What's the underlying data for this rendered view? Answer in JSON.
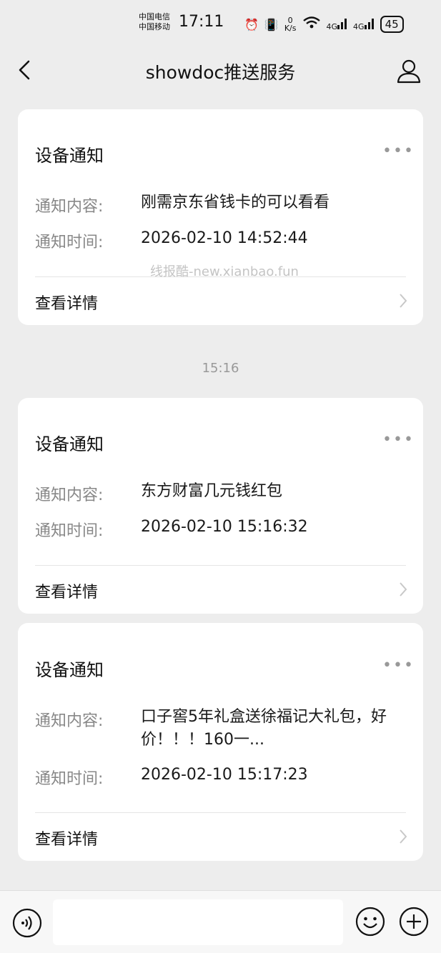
{
  "status": {
    "carrier1": "中国电信",
    "carrier2": "中国移动",
    "time": "17:11",
    "speed_value": "0",
    "speed_unit": "K/s",
    "signal1": "4G",
    "signal2": "4G",
    "battery": "45"
  },
  "header": {
    "title": "showdoc推送服务"
  },
  "watermark": "线报酷-new.xianbao.fun",
  "timestamp": "15:16",
  "field_labels": {
    "content": "通知内容:",
    "time": "通知时间:"
  },
  "cards": [
    {
      "title": "设备通知",
      "content": "刚需京东省钱卡的可以看看",
      "time": "2026-02-10 14:52:44",
      "detail": "查看详情"
    },
    {
      "title": "设备通知",
      "content": "东方财富几元钱红包",
      "time": "2026-02-10 15:16:32",
      "detail": "查看详情"
    },
    {
      "title": "设备通知",
      "content": "口子窖5年礼盒送徐福记大礼包，好价！！！160一...",
      "time": "2026-02-10 15:17:23",
      "detail": "查看详情"
    }
  ],
  "icons": {
    "back": "chevron-left-icon",
    "profile": "person-icon",
    "more": "more-dots-icon",
    "detail_arrow": "chevron-right-icon",
    "voice": "voice-icon",
    "emoji": "emoji-icon",
    "plus": "plus-icon"
  },
  "colors": {
    "background": "#ededed",
    "card": "#ffffff",
    "label": "#888888"
  }
}
